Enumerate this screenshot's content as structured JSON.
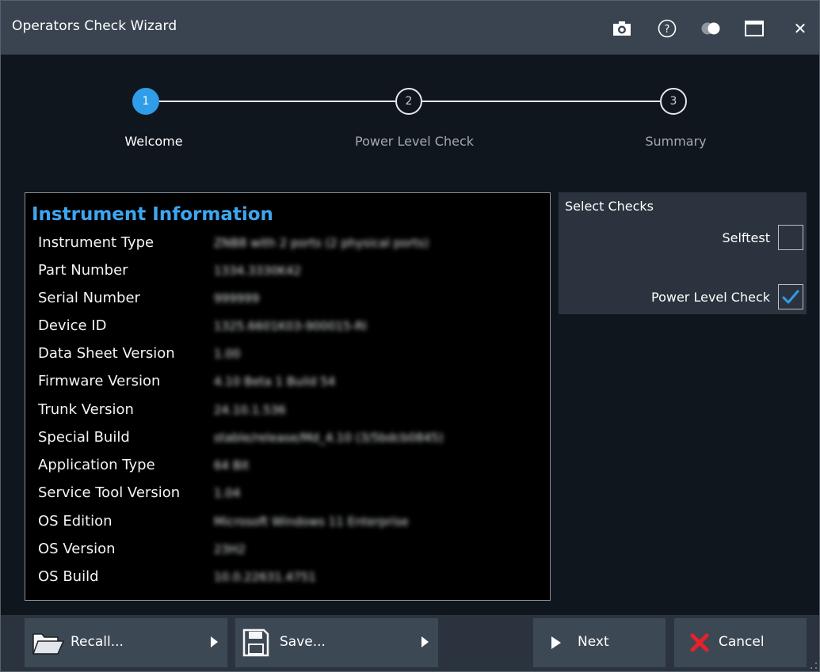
{
  "window": {
    "title": "Operators Check Wizard",
    "icons": [
      "camera-icon",
      "help-icon",
      "toggle-icon",
      "maximize-icon",
      "close-icon"
    ],
    "close_glyph": "✕",
    "help_glyph": "?"
  },
  "steps": [
    {
      "number": "1",
      "label": "Welcome",
      "active": true
    },
    {
      "number": "2",
      "label": "Power Level Check",
      "active": false
    },
    {
      "number": "3",
      "label": "Summary",
      "active": false
    }
  ],
  "info": {
    "title": "Instrument Information",
    "rows": [
      {
        "key": "Instrument Type",
        "value": "ZNB8 with 2 ports (2 physical ports)"
      },
      {
        "key": "Part Number",
        "value": "1334.3330K42"
      },
      {
        "key": "Serial Number",
        "value": "999999"
      },
      {
        "key": "Device ID",
        "value": "1325.6601K03-900015-RI"
      },
      {
        "key": "Data Sheet Version",
        "value": "1.00"
      },
      {
        "key": "Firmware Version",
        "value": "4.10 Beta 1 Build 54"
      },
      {
        "key": "Trunk Version",
        "value": "24.10.1.536"
      },
      {
        "key": "Special Build",
        "value": "stable/release/Md_4.10 (3/5bdcb0845)"
      },
      {
        "key": "Application Type",
        "value": "64 Bit"
      },
      {
        "key": "Service Tool Version",
        "value": "1.04"
      },
      {
        "key": "OS Edition",
        "value": "Microsoft Windows 11 Enterprise"
      },
      {
        "key": "OS Version",
        "value": "23H2"
      },
      {
        "key": "OS Build",
        "value": "10.0.22631.4751"
      }
    ]
  },
  "checks": {
    "title": "Select Checks",
    "items": [
      {
        "label": "Selftest",
        "checked": false
      },
      {
        "label": "Power Level Check",
        "checked": true
      }
    ]
  },
  "footer": {
    "recall_label": "Recall...",
    "save_label": "Save...",
    "next_label": "Next",
    "cancel_label": "Cancel"
  },
  "colors": {
    "accent": "#2f9de7",
    "title_blue": "#3ea6f0",
    "cancel_red": "#e8202a"
  }
}
